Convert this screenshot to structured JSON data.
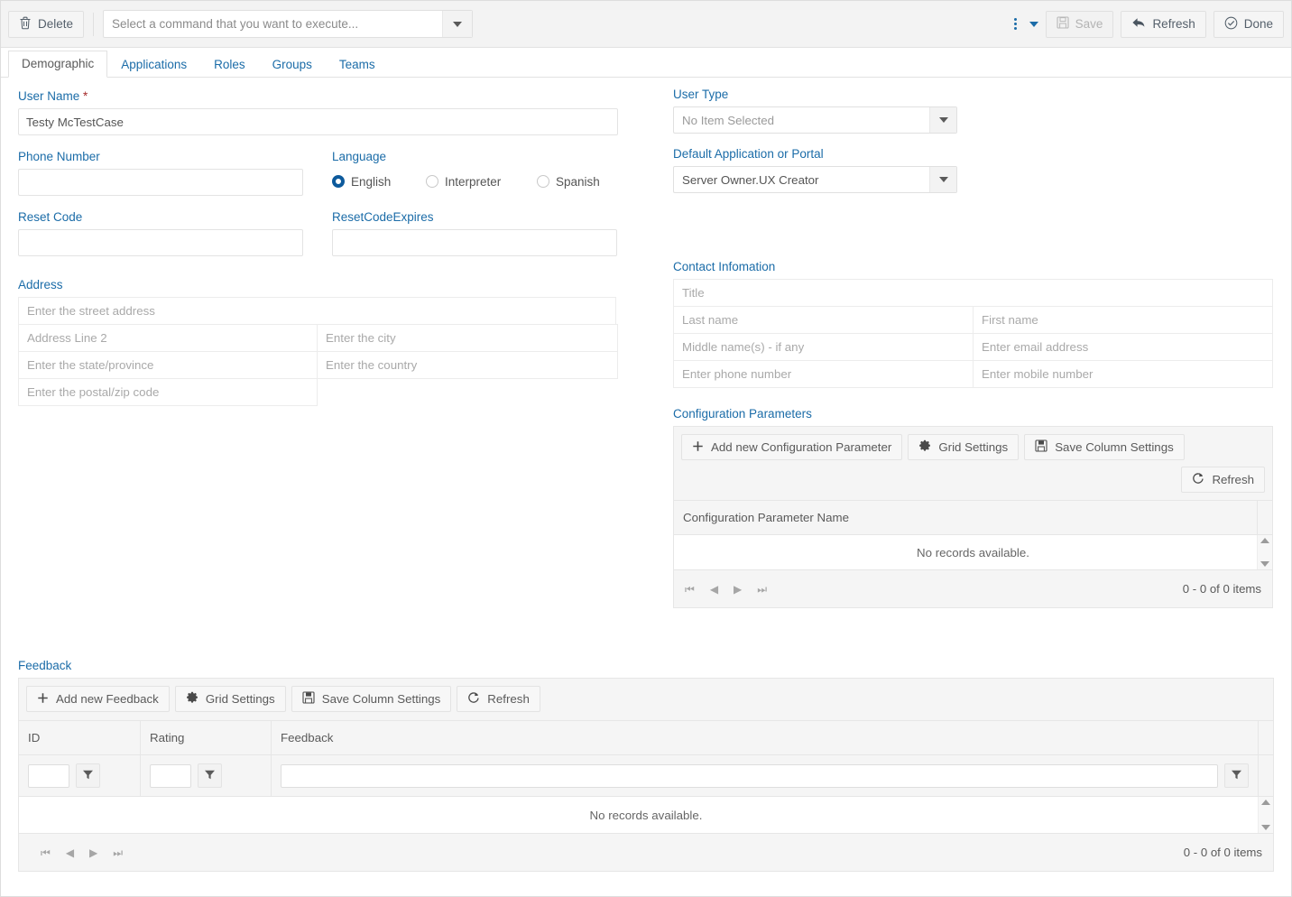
{
  "toolbar": {
    "delete_label": "Delete",
    "command_placeholder": "Select a command that you want to execute...",
    "save_label": "Save",
    "refresh_label": "Refresh",
    "done_label": "Done",
    "kebab_icon": "more-vertical-icon",
    "caret_icon": "chevron-down-icon"
  },
  "tabs": [
    {
      "label": "Demographic",
      "active": true
    },
    {
      "label": "Applications",
      "active": false
    },
    {
      "label": "Roles",
      "active": false
    },
    {
      "label": "Groups",
      "active": false
    },
    {
      "label": "Teams",
      "active": false
    }
  ],
  "demographic": {
    "user_name": {
      "label": "User Name",
      "required_marker": "*",
      "value": "Testy McTestCase"
    },
    "phone_number": {
      "label": "Phone Number",
      "value": ""
    },
    "language": {
      "label": "Language",
      "options": [
        {
          "label": "English",
          "selected": true
        },
        {
          "label": "Interpreter",
          "selected": false
        },
        {
          "label": "Spanish",
          "selected": false
        }
      ]
    },
    "reset_code": {
      "label": "Reset Code",
      "value": ""
    },
    "reset_code_expires": {
      "label": "ResetCodeExpires",
      "value": ""
    },
    "address": {
      "label": "Address",
      "street": "Enter the street address",
      "line2": "Address Line 2",
      "city": "Enter the city",
      "state": "Enter the state/province",
      "country": "Enter the country",
      "postal": "Enter the postal/zip code"
    },
    "user_type": {
      "label": "User Type",
      "value": "No Item Selected"
    },
    "default_application": {
      "label": "Default Application or Portal",
      "value": "Server Owner.UX Creator"
    },
    "contact": {
      "label": "Contact Infomation",
      "title": "Title",
      "last_name": "Last name",
      "first_name": "First name",
      "middle_name": "Middle name(s) - if any",
      "email": "Enter email address",
      "phone": "Enter phone number",
      "mobile": "Enter mobile number"
    }
  },
  "config_params": {
    "label": "Configuration Parameters",
    "add_label": "Add new Configuration Parameter",
    "grid_settings_label": "Grid Settings",
    "save_columns_label": "Save Column Settings",
    "refresh_label": "Refresh",
    "column_header": "Configuration Parameter Name",
    "empty_text": "No records available.",
    "pager_count": "0 - 0 of 0 items"
  },
  "feedback": {
    "label": "Feedback",
    "add_label": "Add new Feedback",
    "grid_settings_label": "Grid Settings",
    "save_columns_label": "Save Column Settings",
    "refresh_label": "Refresh",
    "columns": [
      "ID",
      "Rating",
      "Feedback"
    ],
    "filter_values": {
      "id": "",
      "rating": "",
      "feedback": ""
    },
    "empty_text": "No records available.",
    "pager_count": "0 - 0 of 0 items"
  },
  "icons": {
    "trash": "trash-icon",
    "save_disk": "floppy-disk-icon",
    "back_arrow": "back-arrow-icon",
    "check_circle": "check-circle-icon",
    "plus": "plus-icon",
    "gear": "gear-icon",
    "refresh": "refresh-icon",
    "funnel": "funnel-icon"
  },
  "colors": {
    "accent": "#1b6ca8",
    "panel_bg": "#f5f5f5",
    "border": "#e6e6e6",
    "required": "#a52a2a"
  }
}
